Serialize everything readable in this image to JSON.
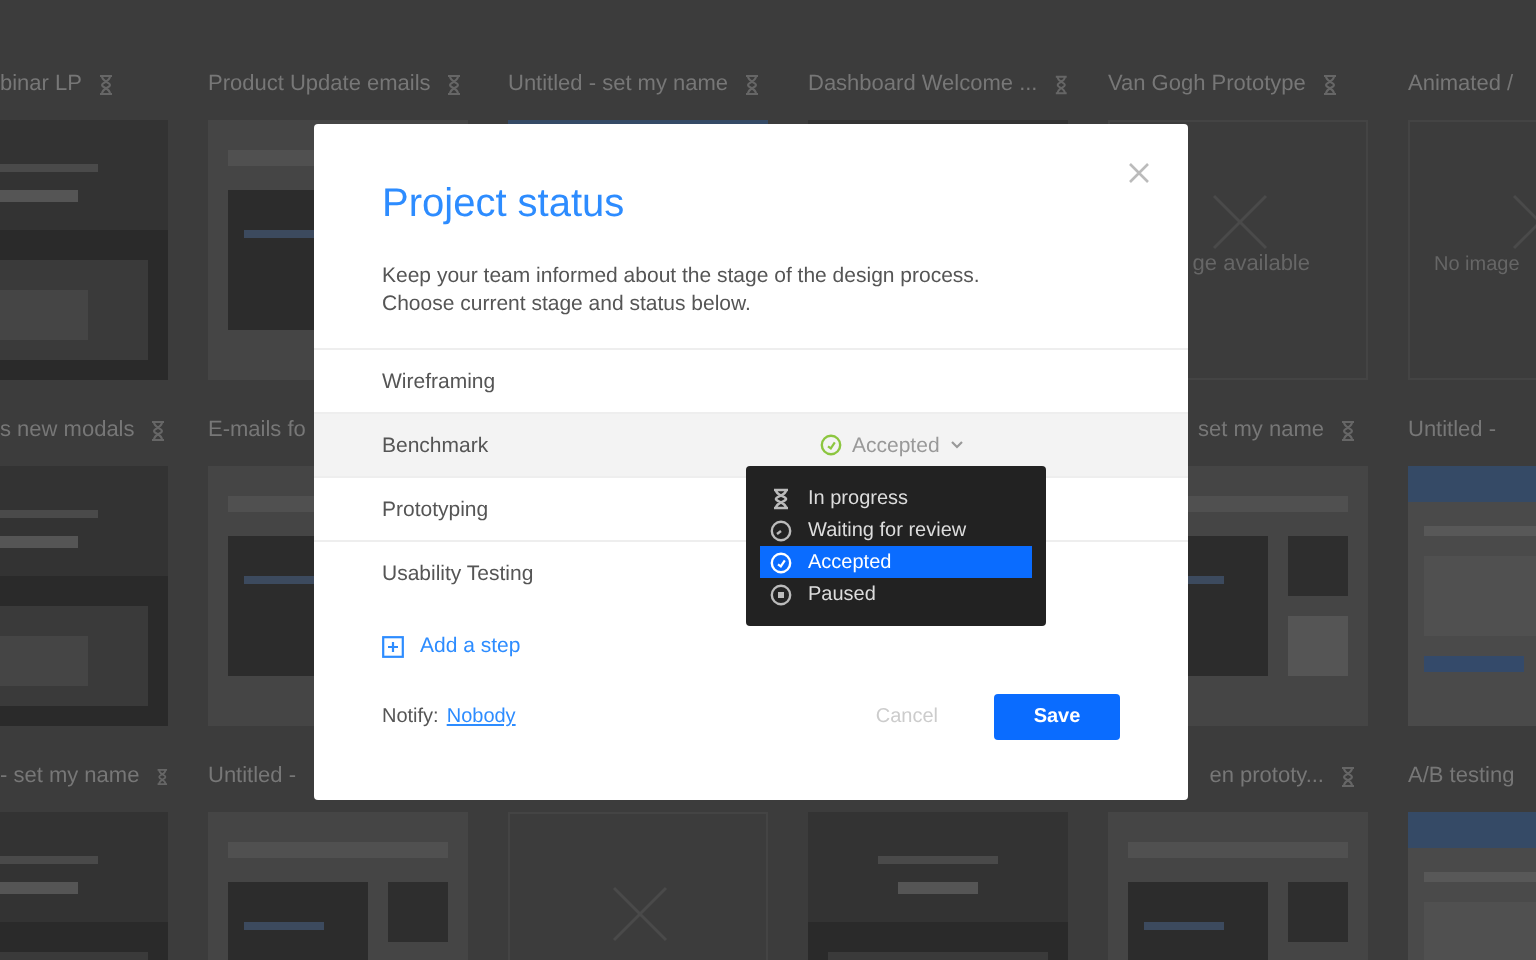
{
  "projects": [
    [
      {
        "kind": "picture",
        "title": "binar LP"
      },
      {
        "kind": "picture",
        "title": "Product Update emails"
      },
      {
        "kind": "picture",
        "title": "Untitled - set my name"
      },
      {
        "kind": "picture",
        "title": "Dashboard Welcome ..."
      },
      {
        "kind": "no_image",
        "title": "Van Gogh Prototype",
        "text": "ge available"
      },
      {
        "kind": "no_image",
        "title": "Animated /",
        "text": "No image"
      }
    ],
    [
      {
        "kind": "picture",
        "title": "s new modals"
      },
      {
        "kind": "picture",
        "title": "E-mails fo"
      },
      {
        "kind": "covered"
      },
      {
        "kind": "covered"
      },
      {
        "kind": "picture",
        "title": "set my name"
      },
      {
        "kind": "picture",
        "title": "Untitled -"
      }
    ],
    [
      {
        "kind": "picture",
        "title": "- set my name"
      },
      {
        "kind": "picture",
        "title": "Untitled -"
      },
      {
        "kind": "no_image"
      },
      {
        "kind": "picture"
      },
      {
        "kind": "picture",
        "title": "en prototy..."
      },
      {
        "kind": "picture",
        "title": "A/B testing"
      }
    ]
  ],
  "dialog": {
    "title": "Project status",
    "description": [
      "Keep your team informed about the stage of the design process.",
      "Choose current stage and status below."
    ],
    "steps": [
      {
        "label": "Wireframing",
        "selected": false
      },
      {
        "label": "Benchmark",
        "selected": true,
        "status": {
          "label": "Accepted",
          "kind": "accepted",
          "expanded": true
        }
      },
      {
        "label": "Prototyping",
        "selected": false
      },
      {
        "label": "Usability Testing",
        "selected": false
      }
    ],
    "status_menu": [
      {
        "label": "In progress",
        "kind": "in_progress",
        "selected": false
      },
      {
        "label": "Waiting for review",
        "kind": "waiting",
        "selected": false
      },
      {
        "label": "Accepted",
        "kind": "accepted",
        "selected": true
      },
      {
        "label": "Paused",
        "kind": "paused",
        "selected": false
      }
    ],
    "add_step": "Add a step",
    "notify_label": "Notify:",
    "notify_value": "Nobody",
    "cancel": "Cancel",
    "save": "Save"
  }
}
